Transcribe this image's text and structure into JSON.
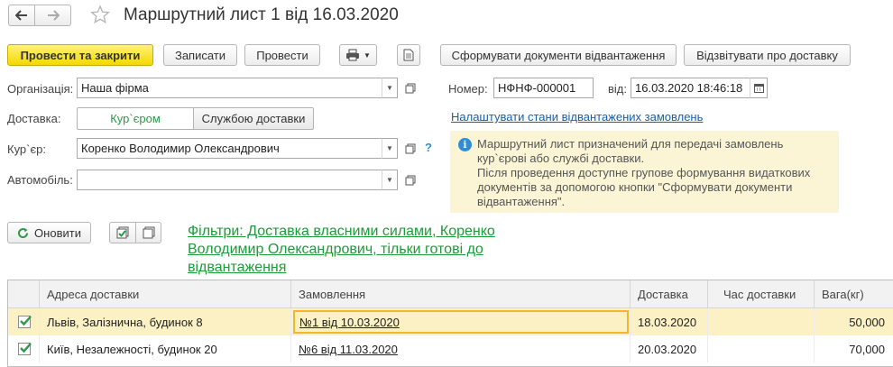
{
  "window": {
    "title": "Маршрутний лист 1 від 16.03.2020"
  },
  "toolbar": {
    "post_close": "Провести та закрити",
    "save": "Записати",
    "post": "Провести",
    "form_docs": "Сформувати документи відвантаження",
    "report_delivery": "Відзвітувати про доставку"
  },
  "form": {
    "org_label": "Організація:",
    "org_value": "Наша фірма",
    "number_label": "Номер:",
    "number_value": "НФНФ-000001",
    "date_label": "від:",
    "date_value": "16.03.2020 18:46:18",
    "delivery_label": "Доставка:",
    "delivery_opt1": "Кур`єром",
    "delivery_opt2": "Службою доставки",
    "settings_link": "Налаштувати стани відвантажених замовлень",
    "courier_label": "Кур`єр:",
    "courier_value": "Коренко Володимир Олександрович",
    "help": "?",
    "car_label": "Автомобіль:",
    "car_value": ""
  },
  "info": {
    "icon": "i",
    "text1": "Маршрутний лист призначений для передачі замовлень кур`єрові або службі доставки.",
    "text2": "Після проведення доступне групове формування видаткових документів за допомогою кнопки \"Сформувати документи відвантаження\"."
  },
  "list_toolbar": {
    "refresh": "Оновити",
    "filters_line1": "Фільтри: Доставка власними силами, Коренко",
    "filters_line2": "Володимир Олександрович, тільки готові до",
    "filters_line3": "відвантаження"
  },
  "table": {
    "columns": [
      "Адреса доставки",
      "Замовлення",
      "Доставка",
      "Час доставки",
      "Вага(кг)"
    ],
    "rows": [
      {
        "checked": true,
        "address": "Львів, Залізнична, будинок 8",
        "order": "№1 від 10.03.2020",
        "delivery": "18.03.2020",
        "time": "",
        "weight": "50,000"
      },
      {
        "checked": true,
        "address": "Київ, Незалежності, будинок 20",
        "order": "№6 від 11.03.2020",
        "delivery": "20.03.2020",
        "time": "",
        "weight": "70,000"
      }
    ]
  },
  "colors": {
    "primary_button": "#f5d800",
    "link": "#1b5ea8",
    "filter_link": "#1e9a3a",
    "info_bg": "#fbf5d6",
    "selected_row": "#fbf1c4"
  }
}
